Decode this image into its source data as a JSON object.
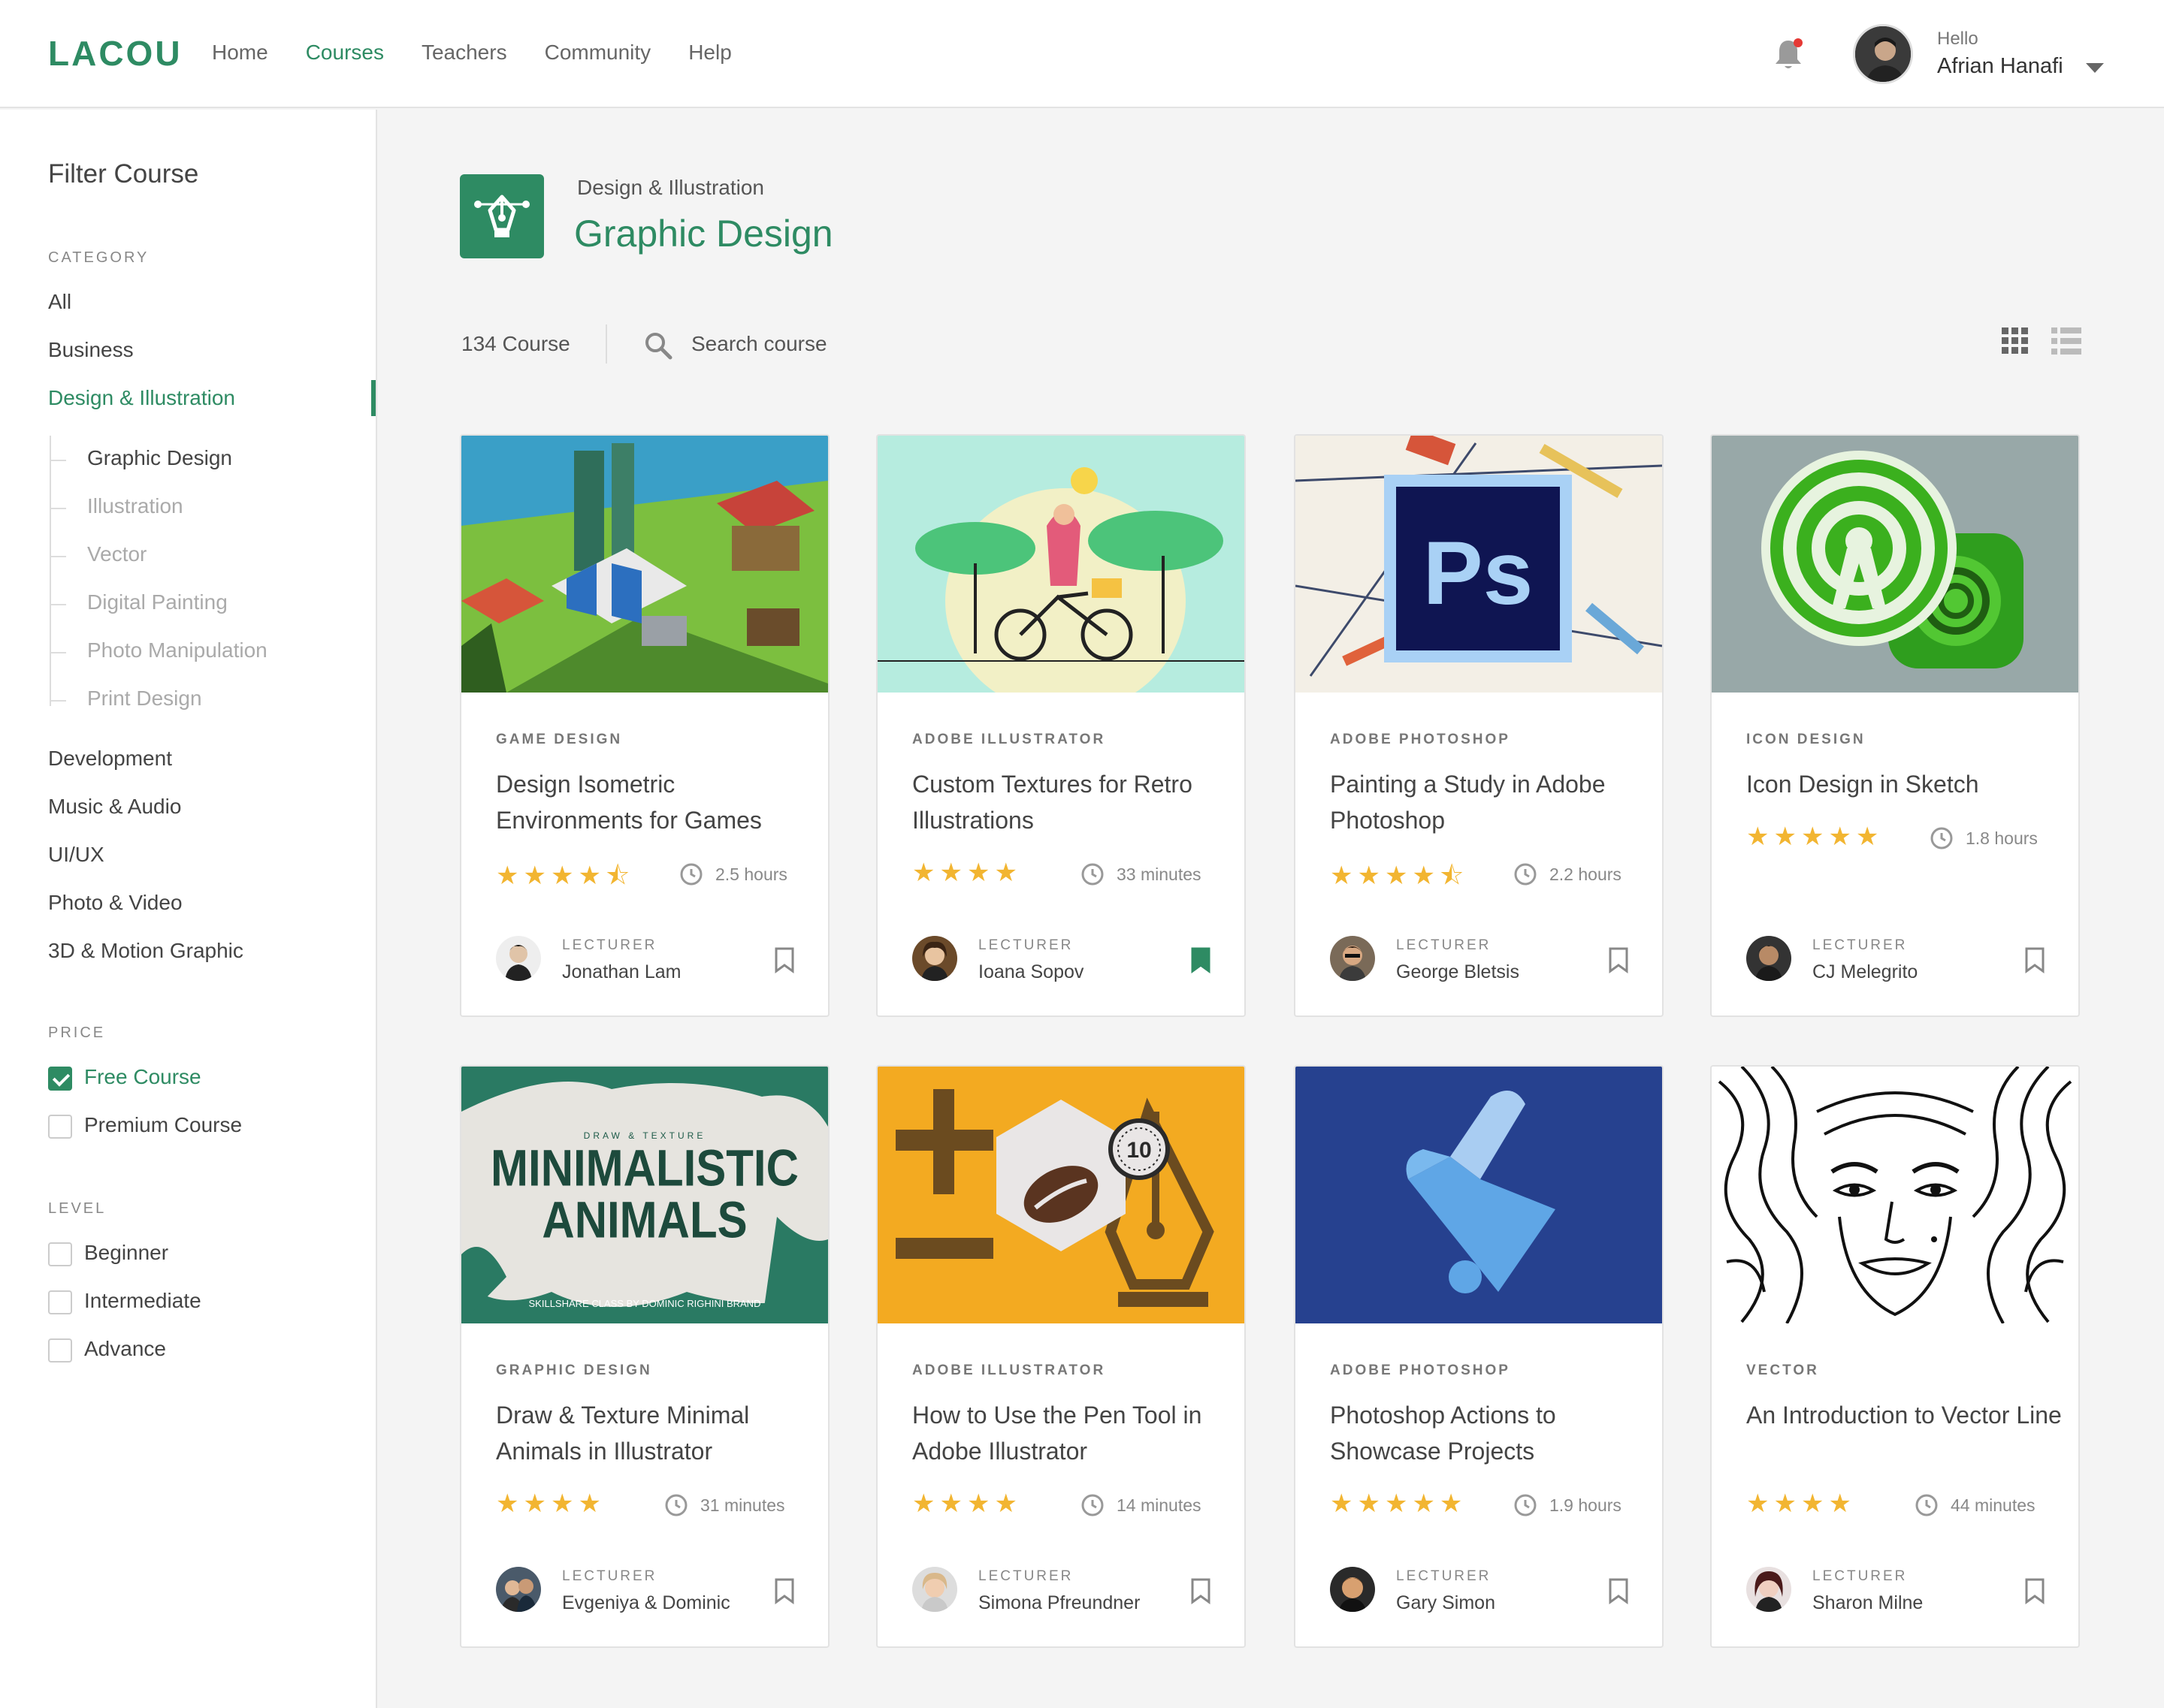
{
  "app": {
    "logo": "LACOU"
  },
  "nav": [
    {
      "label": "Home",
      "active": false
    },
    {
      "label": "Courses",
      "active": true
    },
    {
      "label": "Teachers",
      "active": false
    },
    {
      "label": "Community",
      "active": false
    },
    {
      "label": "Help",
      "active": false
    }
  ],
  "user": {
    "greeting": "Hello",
    "name": "Afrian Hanafi",
    "has_notification": true
  },
  "sidebar": {
    "title": "Filter Course",
    "category_label": "CATEGORY",
    "categories": [
      "All",
      "Business",
      "Design & Illustration"
    ],
    "active_category": "Design & Illustration",
    "subcategories": [
      "Graphic Design",
      "Illustration",
      "Vector",
      "Digital Painting",
      "Photo Manipulation",
      "Print Design"
    ],
    "active_subcategory": "Graphic Design",
    "more_categories": [
      "Development",
      "Music & Audio",
      "UI/UX",
      "Photo & Video",
      "3D & Motion Graphic"
    ],
    "price_label": "PRICE",
    "price_options": [
      {
        "label": "Free Course",
        "checked": true
      },
      {
        "label": "Premium Course",
        "checked": false
      }
    ],
    "level_label": "LEVEL",
    "level_options": [
      {
        "label": "Beginner",
        "checked": false
      },
      {
        "label": "Intermediate",
        "checked": false
      },
      {
        "label": "Advance",
        "checked": false
      }
    ]
  },
  "header": {
    "breadcrumb": "Design & Illustration",
    "title": "Graphic Design",
    "course_count": "134 Course",
    "search_placeholder": "Search course",
    "icon": "pen-tool-icon"
  },
  "colors": {
    "accent": "#2e8b63",
    "star": "#f2b531"
  },
  "lecturer_label": "LECTURER",
  "courses": [
    {
      "tag": "GAME DESIGN",
      "title": "Design Isometric Environments for Games",
      "rating": 4.5,
      "duration": "2.5 hours",
      "lecturer": "Jonathan Lam",
      "bookmarked": false
    },
    {
      "tag": "ADOBE ILLUSTRATOR",
      "title": "Custom Textures for Retro Illustrations",
      "rating": 4,
      "duration": "33 minutes",
      "lecturer": "Ioana Sopov",
      "bookmarked": true
    },
    {
      "tag": "ADOBE PHOTOSHOP",
      "title": "Painting a Study in Adobe Photoshop",
      "rating": 4.5,
      "duration": "2.2 hours",
      "lecturer": "George Bletsis",
      "bookmarked": false
    },
    {
      "tag": "ICON DESIGN",
      "title": "Icon Design in Sketch",
      "rating": 5,
      "duration": "1.8 hours",
      "lecturer": "CJ Melegrito",
      "bookmarked": false
    },
    {
      "tag": "GRAPHIC DESIGN",
      "title": "Draw & Texture Minimal Animals in Illustrator",
      "rating": 4,
      "duration": "31 minutes",
      "lecturer": "Evgeniya & Dominic",
      "bookmarked": false
    },
    {
      "tag": "ADOBE ILLUSTRATOR",
      "title": "How to Use the Pen Tool in Adobe Illustrator",
      "rating": 4,
      "duration": "14 minutes",
      "lecturer": "Simona Pfreundner",
      "bookmarked": false
    },
    {
      "tag": "ADOBE PHOTOSHOP",
      "title": "Photoshop Actions to Showcase Projects",
      "rating": 5,
      "duration": "1.9 hours",
      "lecturer": "Gary Simon",
      "bookmarked": false
    },
    {
      "tag": "VECTOR",
      "title": "An Introduction to Vector Line",
      "rating": 4,
      "duration": "44 minutes",
      "lecturer": "Sharon Milne",
      "bookmarked": false
    }
  ],
  "thumb_text": {
    "ps": "Ps",
    "animals_top": "DRAW & TEXTURE",
    "animals_line1": "MINIMALISTIC",
    "animals_line2": "ANIMALS",
    "animals_bottom": "SKILLSHARE CLASS BY DOMINIC RIGHINI BRAND",
    "pen_badge": "10"
  }
}
